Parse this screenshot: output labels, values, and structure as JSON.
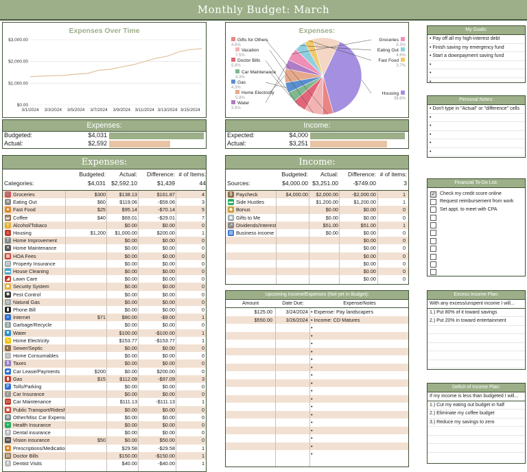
{
  "title": "Monthly Budget: March",
  "colors": {
    "accent": "#9caf88",
    "dark": "#3d4f34",
    "alt_row": "#f2e1d3",
    "bar": "#e8c4a4",
    "line": "#e0c19b"
  },
  "chart_data": [
    {
      "type": "line",
      "title": "Expenses Over Time",
      "x": [
        "3/1/2024",
        "3/2/2024",
        "3/3/2024",
        "3/4/2024",
        "3/5/2024",
        "3/6/2024",
        "3/7/2024",
        "3/8/2024",
        "3/9/2024",
        "3/10/2024",
        "3/11/2024",
        "3/12/2024",
        "3/13/2024",
        "3/14/2024",
        "3/15/2024",
        "3/16/2024"
      ],
      "values": [
        1300,
        1330,
        1350,
        1360,
        1420,
        1450,
        1600,
        1640,
        1750,
        1850,
        2000,
        2150,
        2250,
        2450,
        2550,
        2592
      ],
      "x_ticks": [
        "3/1/2024",
        "3/3/2024",
        "3/5/2024",
        "3/7/2024",
        "3/9/2024",
        "3/11/2024",
        "3/13/2024",
        "3/15/2024"
      ],
      "y_ticks": [
        "$0.00",
        "$1,000.00",
        "$2,000.00",
        "$3,000.00"
      ],
      "ylim": [
        0,
        3000
      ],
      "grid": true
    },
    {
      "type": "pie",
      "title": "Expenses:",
      "slices": [
        {
          "name": "Housing",
          "value": 38.6,
          "pct": "38.6%",
          "color": "#a58fe0"
        },
        {
          "name": "Gifts for Others",
          "value": 4.6,
          "pct": "4.6%",
          "color": "#e98585"
        },
        {
          "name": "Vacation",
          "value": 7.5,
          "pct": "7.5%",
          "color": "#f4b3b3"
        },
        {
          "name": "Doctor Bills",
          "value": 5.8,
          "pct": "5.8%",
          "color": "#e2667a"
        },
        {
          "name": "Car Maintenance",
          "value": 4.3,
          "pct": "4.3%",
          "color": "#7fb88e"
        },
        {
          "name": "Gas",
          "value": 4.3,
          "pct": "4.3%",
          "color": "#5a8fd0"
        },
        {
          "name": "Home Electricity",
          "value": 5.9,
          "pct": "5.9%",
          "color": "#e6a98c"
        },
        {
          "name": "Water",
          "value": 3.9,
          "pct": "3.9%",
          "color": "#b07cc6"
        },
        {
          "name": "Groceries",
          "value": 5.3,
          "pct": "5.3%",
          "color": "#f08fb6"
        },
        {
          "name": "Eating Out",
          "value": 4.6,
          "pct": "4.6%",
          "color": "#8fd0e0"
        },
        {
          "name": "Fast Food",
          "value": 3.7,
          "pct": "3.7%",
          "color": "#f2c96b"
        },
        {
          "name": "Other",
          "value": 11.5,
          "pct": "",
          "color": "#f3d6c4"
        }
      ]
    }
  ],
  "exp_summary": {
    "header": "Expenses:",
    "budgeted_label": "Budgeted:",
    "budgeted": "$4,031",
    "actual_label": "Actual:",
    "actual": "$2,592",
    "bar_fraction": 0.643
  },
  "inc_summary": {
    "header": "Income:",
    "expected_label": "Expected:",
    "expected": "$4,000",
    "actual_label": "Actual:",
    "actual": "$3,251",
    "bar_fraction": 0.813
  },
  "expenses": {
    "header": "Expenses:",
    "col_budgeted": "Budgeted:",
    "col_actual": "Actual:",
    "col_diff": "Difference:",
    "col_items": "# of Items:",
    "cat_label": "Categories:",
    "tot_budgeted": "$4,031",
    "tot_actual": "$2,592.10",
    "tot_diff": "$1,439",
    "tot_items": "44",
    "rows": [
      {
        "name": "Groceries",
        "b": "$300",
        "a": "$138.13",
        "d": "$161.87",
        "n": "4",
        "icon": "cart-icon",
        "ic": "#d9534f",
        "g": "🛒"
      },
      {
        "name": "Eating Out",
        "b": "$60",
        "a": "$119.06",
        "d": "-$59.06",
        "n": "3",
        "icon": "utensils-icon",
        "ic": "#888",
        "g": "✕"
      },
      {
        "name": "Fast Food",
        "b": "$25",
        "a": "$95.14",
        "d": "-$70.14",
        "n": "5",
        "icon": "burger-icon",
        "ic": "#e08a2e",
        "g": "●"
      },
      {
        "name": "Coffee",
        "b": "$40",
        "a": "$69.01",
        "d": "-$29.01",
        "n": "7",
        "icon": "coffee-icon",
        "ic": "#8b5a2b",
        "g": "☕"
      },
      {
        "name": "Alcohol/Tobaco",
        "b": "",
        "a": "$0.00",
        "d": "$0.00",
        "n": "0",
        "icon": "glass-icon",
        "ic": "#e3b23c",
        "g": "Y"
      },
      {
        "name": "Housing",
        "b": "$1,200",
        "a": "$1,000.00",
        "d": "$200.00",
        "n": "1",
        "icon": "house-icon",
        "ic": "#c0392b",
        "g": "⌂"
      },
      {
        "name": "Home Improvement",
        "b": "",
        "a": "$0.00",
        "d": "$0.00",
        "n": "0",
        "icon": "hammer-icon",
        "ic": "#7f8c8d",
        "g": "T"
      },
      {
        "name": "Home Maintenance",
        "b": "",
        "a": "$0.00",
        "d": "$0.00",
        "n": "0",
        "icon": "wrench-icon",
        "ic": "#555",
        "g": "✕"
      },
      {
        "name": "HOA Fees",
        "b": "",
        "a": "$0.00",
        "d": "$0.00",
        "n": "0",
        "icon": "building-icon",
        "ic": "#c0392b",
        "g": "▦"
      },
      {
        "name": "Property Insurance",
        "b": "",
        "a": "$0.00",
        "d": "$0.00",
        "n": "0",
        "icon": "document-icon",
        "ic": "#95a5a6",
        "g": "▤"
      },
      {
        "name": "House Cleaning",
        "b": "",
        "a": "$0.00",
        "d": "$0.00",
        "n": "0",
        "icon": "sponge-icon",
        "ic": "#3fa7d6",
        "g": "▬"
      },
      {
        "name": "Lawn Care",
        "b": "",
        "a": "$0.00",
        "d": "$0.00",
        "n": "0",
        "icon": "mower-icon",
        "ic": "#c0392b",
        "g": "◢"
      },
      {
        "name": "Security System",
        "b": "",
        "a": "$0.00",
        "d": "$0.00",
        "n": "0",
        "icon": "shield-icon",
        "ic": "#e3b23c",
        "g": "◆"
      },
      {
        "name": "Pest Control",
        "b": "",
        "a": "$0.00",
        "d": "$0.00",
        "n": "0",
        "icon": "bug-icon",
        "ic": "#333",
        "g": "✱"
      },
      {
        "name": "Natural Gas",
        "b": "",
        "a": "$0.00",
        "d": "$0.00",
        "n": "0",
        "icon": "meter-icon",
        "ic": "#95a5a6",
        "g": "◎"
      },
      {
        "name": "Phone Bill",
        "b": "",
        "a": "$0.00",
        "d": "$0.00",
        "n": "0",
        "icon": "phone-icon",
        "ic": "#222",
        "g": "▮"
      },
      {
        "name": "Internet",
        "b": "$71",
        "a": "$80.00",
        "d": "-$9.00",
        "n": "1",
        "icon": "wifi-icon",
        "ic": "#2f6fd1",
        "g": "≈"
      },
      {
        "name": "Garbage/Recycle",
        "b": "",
        "a": "$0.00",
        "d": "$0.00",
        "n": "0",
        "icon": "trash-icon",
        "ic": "#95a5a6",
        "g": "▯"
      },
      {
        "name": "Water",
        "b": "",
        "a": "$100.00",
        "d": "-$100.00",
        "n": "1",
        "icon": "droplet-icon",
        "ic": "#2f8fd1",
        "g": "▼"
      },
      {
        "name": "Home Electricity",
        "b": "",
        "a": "$153.77",
        "d": "-$153.77",
        "n": "1",
        "icon": "lightning-icon",
        "ic": "#f1c40f",
        "g": "ϟ"
      },
      {
        "name": "Sewer/Septic",
        "b": "",
        "a": "$0.00",
        "d": "$0.00",
        "n": "0",
        "icon": "pipe-icon",
        "ic": "#8b6d4a",
        "g": "◐"
      },
      {
        "name": "Home Consumables",
        "b": "",
        "a": "$0.00",
        "d": "$0.00",
        "n": "0",
        "icon": "roll-icon",
        "ic": "#bbb",
        "g": "○"
      },
      {
        "name": "Taxes",
        "b": "",
        "a": "$0.00",
        "d": "$0.00",
        "n": "0",
        "icon": "tax-icon",
        "ic": "#8e7cc3",
        "g": "$"
      },
      {
        "name": "Car Lease/Payments",
        "b": "$200",
        "a": "$0.00",
        "d": "$200.00",
        "n": "0",
        "icon": "car-icon",
        "ic": "#2f6fd1",
        "g": "▰"
      },
      {
        "name": "Gas",
        "b": "$15",
        "a": "$112.09",
        "d": "-$97.09",
        "n": "3",
        "icon": "fuel-icon",
        "ic": "#c0392b",
        "g": "▮"
      },
      {
        "name": "Tolls/Parking",
        "b": "",
        "a": "$0.00",
        "d": "$0.00",
        "n": "0",
        "icon": "parking-icon",
        "ic": "#2f6fd1",
        "g": "P"
      },
      {
        "name": "Car Insurance",
        "b": "",
        "a": "$0.00",
        "d": "$0.00",
        "n": "0",
        "icon": "pen-icon",
        "ic": "#999",
        "g": "/"
      },
      {
        "name": "Car Maintenance",
        "b": "",
        "a": "$111.13",
        "d": "-$111.13",
        "n": "1",
        "icon": "toolbox-icon",
        "ic": "#c0392b",
        "g": "▭"
      },
      {
        "name": "Public Transport/Rideshare",
        "b": "",
        "a": "$0.00",
        "d": "$0.00",
        "n": "0",
        "icon": "bus-icon",
        "ic": "#c0392b",
        "g": "▣"
      },
      {
        "name": "Other/Misc Car Expenses",
        "b": "",
        "a": "$0.00",
        "d": "$0.00",
        "n": "0",
        "icon": "gear-icon",
        "ic": "#7f8c8d",
        "g": "✲"
      },
      {
        "name": "Health Insurance",
        "b": "",
        "a": "$0.00",
        "d": "$0.00",
        "n": "0",
        "icon": "health-icon",
        "ic": "#27ae60",
        "g": "+"
      },
      {
        "name": "Dental insurance",
        "b": "",
        "a": "$0.00",
        "d": "$0.00",
        "n": "0",
        "icon": "tooth-icon",
        "ic": "#bbb",
        "g": "ᴥ"
      },
      {
        "name": "Vision insurance",
        "b": "$50",
        "a": "$0.00",
        "d": "$50.00",
        "n": "0",
        "icon": "glasses-icon",
        "ic": "#555",
        "g": "∞"
      },
      {
        "name": "Prescriptions/Medication",
        "b": "",
        "a": "$29.58",
        "d": "-$29.58",
        "n": "1",
        "icon": "pill-icon",
        "ic": "#e08a2e",
        "g": "●"
      },
      {
        "name": "Doctor Bills",
        "b": "",
        "a": "$150.00",
        "d": "-$150.00",
        "n": "1",
        "icon": "clipboard-icon",
        "ic": "#8b6d4a",
        "g": "▤"
      },
      {
        "name": "Dentist Visits",
        "b": "",
        "a": "$40.00",
        "d": "-$40.00",
        "n": "1",
        "icon": "tooth-icon",
        "ic": "#bbb",
        "g": "ᴥ"
      }
    ]
  },
  "income": {
    "header": "Income:",
    "col_budgeted": "Budgeted:",
    "col_actual": "Actual:",
    "col_diff": "Difference:",
    "col_items": "# of items:",
    "src_label": "Sources:",
    "tot_budgeted": "$4,000.00",
    "tot_actual": "$3,251.00",
    "tot_diff": "-$749.00",
    "tot_items": "3",
    "rows": [
      {
        "name": "Paycheck",
        "b": "$4,000.00",
        "a": "$2,000.00",
        "d": "-$2,000.00",
        "n": "1",
        "icon": "money-bag-icon",
        "ic": "#8b6d4a",
        "g": "$"
      },
      {
        "name": "Side Hustles",
        "b": "",
        "a": "$1,200.00",
        "d": "$1,200.00",
        "n": "1",
        "icon": "cash-icon",
        "ic": "#27ae60",
        "g": "▬"
      },
      {
        "name": "Bonus",
        "b": "",
        "a": "$0.00",
        "d": "$0.00",
        "n": "0",
        "icon": "bag-icon",
        "ic": "#c9a13b",
        "g": "◆"
      },
      {
        "name": "Gifts to Me",
        "b": "",
        "a": "$0.00",
        "d": "$0.00",
        "n": "0",
        "icon": "gift-icon",
        "ic": "#95a5a6",
        "g": "▣"
      },
      {
        "name": "Dividends/Interest",
        "b": "",
        "a": "$51.00",
        "d": "$51.00",
        "n": "1",
        "icon": "trend-icon",
        "ic": "#888",
        "g": "↗"
      },
      {
        "name": "Business income",
        "b": "",
        "a": "$0.00",
        "d": "$0.00",
        "n": "0",
        "icon": "bar-chart-icon",
        "ic": "#2f6fd1",
        "g": "▥"
      },
      {
        "name": "",
        "b": "",
        "a": "",
        "d": "$0.00",
        "n": "0"
      },
      {
        "name": "",
        "b": "",
        "a": "",
        "d": "$0.00",
        "n": "0"
      },
      {
        "name": "",
        "b": "",
        "a": "",
        "d": "$0.00",
        "n": "0"
      },
      {
        "name": "",
        "b": "",
        "a": "",
        "d": "$0.00",
        "n": "0"
      },
      {
        "name": "",
        "b": "",
        "a": "",
        "d": "$0.00",
        "n": "0"
      },
      {
        "name": "",
        "b": "",
        "a": "",
        "d": "$0.00",
        "n": "0"
      }
    ]
  },
  "upcoming": {
    "header": "Upcoming Income/Expenses (Not yet in Budget):",
    "col_amount": "Amount",
    "col_date": "Date Due:",
    "col_notes": "Expense/Notes",
    "rows": [
      {
        "amount": "$125.00",
        "date": "3/24/2024",
        "note": "• Expense: Pay landscapers"
      },
      {
        "amount": "$550.00",
        "date": "3/26/2024",
        "note": "• Income: CD Matures"
      },
      {
        "amount": "",
        "date": "",
        "note": "•"
      },
      {
        "amount": "",
        "date": "",
        "note": "•"
      },
      {
        "amount": "",
        "date": "",
        "note": "•"
      },
      {
        "amount": "",
        "date": "",
        "note": "•"
      },
      {
        "amount": "",
        "date": "",
        "note": "•"
      },
      {
        "amount": "",
        "date": "",
        "note": "•"
      },
      {
        "amount": "",
        "date": "",
        "note": "•"
      },
      {
        "amount": "",
        "date": "",
        "note": "•"
      },
      {
        "amount": "",
        "date": "",
        "note": "•"
      },
      {
        "amount": "",
        "date": "",
        "note": "•"
      },
      {
        "amount": "",
        "date": "",
        "note": "•"
      },
      {
        "amount": "",
        "date": "",
        "note": "•"
      },
      {
        "amount": "",
        "date": "",
        "note": "•"
      },
      {
        "amount": "",
        "date": "",
        "note": "•"
      },
      {
        "amount": "",
        "date": "",
        "note": "•"
      },
      {
        "amount": "",
        "date": "",
        "note": "•"
      },
      {
        "amount": "",
        "date": "",
        "note": "•"
      }
    ]
  },
  "goals": {
    "header": "My Goals:",
    "items": [
      "• Pay off all my high-interest debt",
      "• Finish saving my emergency fund",
      "• Start a downpayment saving fund",
      "•",
      "•",
      "•"
    ]
  },
  "notes": {
    "header": "Personal Notes:",
    "items": [
      "• Don't type in \"Actual\" or \"difference\" cells",
      "•",
      "•",
      "•",
      "•",
      "•",
      "•"
    ]
  },
  "todo": {
    "header": "Financial To-Do List:",
    "items": [
      {
        "text": "Check my credit score online",
        "checked": true
      },
      {
        "text": "Request reimbursement from work",
        "checked": false
      },
      {
        "text": "Set appt. to meet with CPA",
        "checked": false
      },
      {
        "text": "",
        "checked": false
      },
      {
        "text": "",
        "checked": false
      },
      {
        "text": "",
        "checked": false
      },
      {
        "text": "",
        "checked": false
      },
      {
        "text": "",
        "checked": false
      },
      {
        "text": "",
        "checked": false
      },
      {
        "text": "",
        "checked": false
      },
      {
        "text": "",
        "checked": false
      }
    ]
  },
  "excess": {
    "header": "Excess Income Plan:",
    "subtitle": "With any excess/unspent income I will...",
    "items": [
      "1.) Put 80% of it toward savings",
      "2.) Put 20% in toward entertainment",
      "",
      "",
      "",
      "",
      "",
      ""
    ]
  },
  "deficit": {
    "header": "Deficit of Income Plan:",
    "subtitle": "If my income is less than budgeted I will...",
    "items": [
      "1.) Cut my eating out budget in half",
      "2.) Eliminate my coffee budget",
      "3.) Reduce my savings to zero",
      "",
      "",
      ""
    ]
  }
}
